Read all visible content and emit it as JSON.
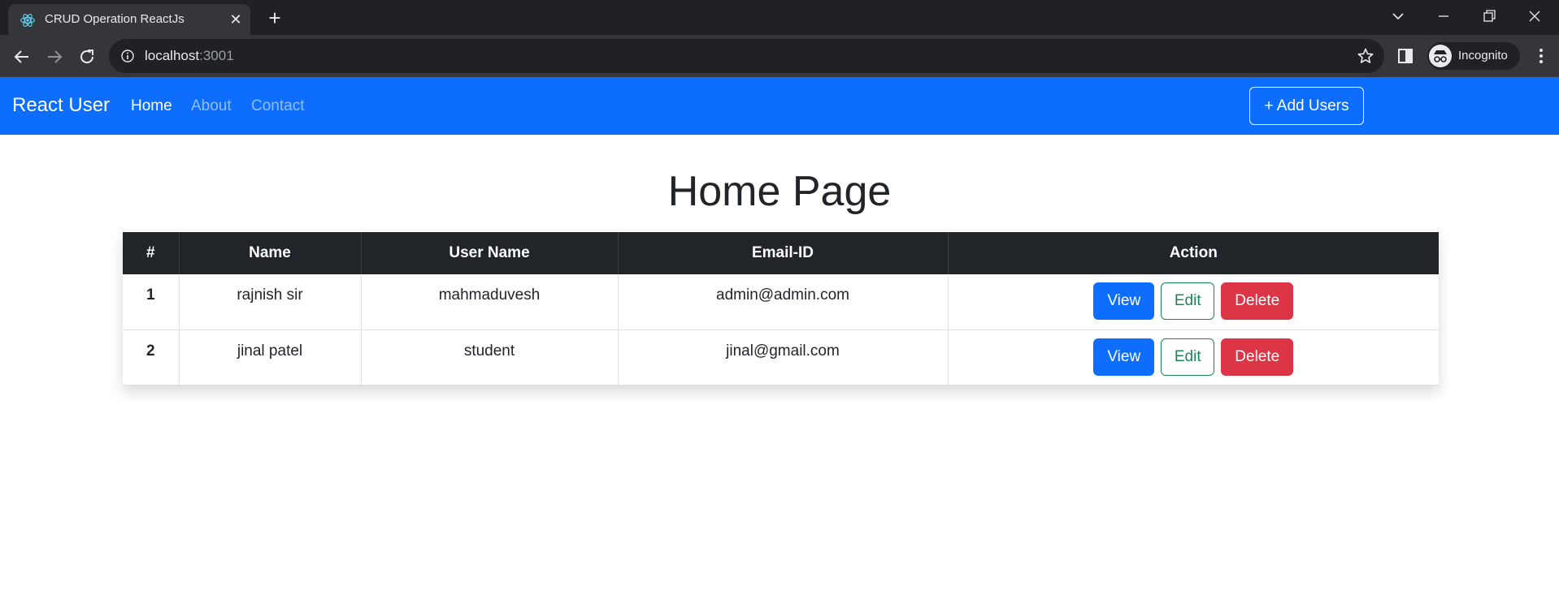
{
  "browser": {
    "tab_title": "CRUD Operation ReactJs",
    "url_host": "localhost",
    "url_port": ":3001",
    "profile_label": "Incognito"
  },
  "navbar": {
    "brand": "React User",
    "links": [
      "Home",
      "About",
      "Contact"
    ],
    "active_link": "Home",
    "add_button": "+ Add Users",
    "color": "#0d6efd"
  },
  "main": {
    "title": "Home Page",
    "table": {
      "headers": [
        "#",
        "Name",
        "User Name",
        "Email-ID",
        "Action"
      ],
      "rows": [
        {
          "id": "1",
          "name": "rajnish sir",
          "username": "mahmaduvesh",
          "email": "admin@admin.com"
        },
        {
          "id": "2",
          "name": "jinal patel",
          "username": "student",
          "email": "jinal@gmail.com"
        }
      ],
      "actions": {
        "view": "View",
        "edit": "Edit",
        "delete": "Delete"
      }
    }
  },
  "icons": {
    "favicon": "react-logo-icon",
    "tab_close": "close-icon",
    "new_tab": "plus-icon",
    "back": "arrow-left-icon",
    "forward": "arrow-right-icon",
    "reload": "reload-icon",
    "site_info": "info-icon",
    "bookmark": "star-icon",
    "side_panel": "side-panel-icon",
    "incognito": "incognito-icon",
    "menu": "three-dots-icon"
  },
  "colors": {
    "view": "#0d6efd",
    "edit": "#198754",
    "delete": "#dc3545",
    "table_header": "#212529"
  }
}
